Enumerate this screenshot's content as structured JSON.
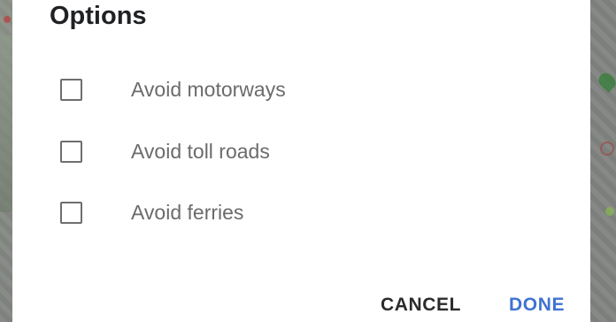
{
  "dialog": {
    "title": "Options",
    "options": [
      {
        "label": "Avoid motorways",
        "checked": false
      },
      {
        "label": "Avoid toll roads",
        "checked": false
      },
      {
        "label": "Avoid ferries",
        "checked": false
      }
    ],
    "actions": {
      "cancel_label": "CANCEL",
      "done_label": "DONE"
    }
  },
  "colors": {
    "accent": "#3f73d1",
    "scrim": "#808380",
    "dialog_bg": "#ffffff"
  }
}
